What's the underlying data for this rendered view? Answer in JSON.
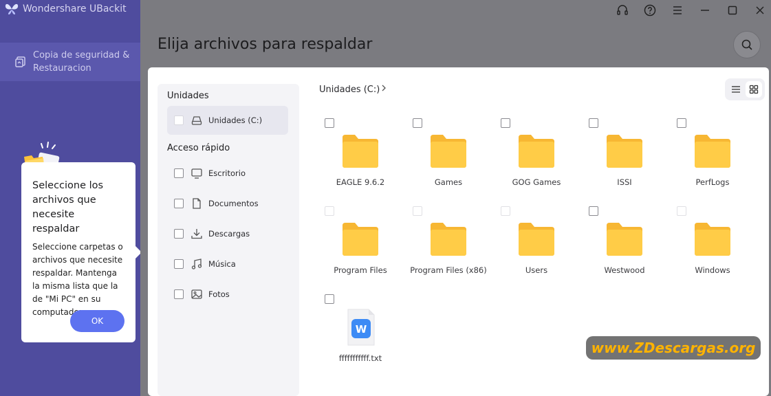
{
  "app": {
    "title": "Wondershare UBackit"
  },
  "sidebar": {
    "nav_item": "Copia de seguridad & Restauracion"
  },
  "tooltip": {
    "title": "Seleccione los archivos que necesite respaldar",
    "body": "Seleccione carpetas o archivos que necesite respaldar. Mantenga la misma lista que la de \"Mi PC\" en su computadora.",
    "ok_label": "OK"
  },
  "header": {
    "title": "Elija archivos para respaldar"
  },
  "left_pane": {
    "drives_title": "Unidades",
    "drive_item": "Unidades (C:)",
    "quick_title": "Acceso rápido",
    "quick_items": [
      {
        "label": "Escritorio",
        "icon": "monitor-icon"
      },
      {
        "label": "Documentos",
        "icon": "document-icon"
      },
      {
        "label": "Descargas",
        "icon": "download-icon"
      },
      {
        "label": "Música",
        "icon": "music-icon"
      },
      {
        "label": "Fotos",
        "icon": "image-icon"
      }
    ]
  },
  "content": {
    "breadcrumb": "Unidades (C:)",
    "items": [
      {
        "name": "EAGLE 9.6.2",
        "type": "folder"
      },
      {
        "name": "Games",
        "type": "folder"
      },
      {
        "name": "GOG Games",
        "type": "folder"
      },
      {
        "name": "ISSI",
        "type": "folder"
      },
      {
        "name": "PerfLogs",
        "type": "folder"
      },
      {
        "name": "Program Files",
        "type": "folder"
      },
      {
        "name": "Program Files (x86)",
        "type": "folder"
      },
      {
        "name": "Users",
        "type": "folder"
      },
      {
        "name": "Westwood",
        "type": "folder"
      },
      {
        "name": "Windows",
        "type": "folder"
      },
      {
        "name": "fffffffffff.txt",
        "type": "file"
      }
    ]
  },
  "watermark": {
    "text": "www.ZDescargas.org"
  },
  "colors": {
    "sidebar": "#4f4c9e",
    "accent": "#5d72f0",
    "folder": "#fcc23a"
  }
}
